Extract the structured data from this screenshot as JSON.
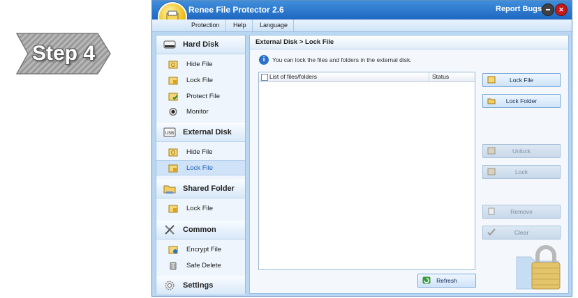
{
  "step": {
    "label": "Step 4"
  },
  "app": {
    "title": "Renee File Protector 2.6",
    "report_bugs": "Report Bugs",
    "menu": [
      "Protection",
      "Help",
      "Language"
    ]
  },
  "sidebar": {
    "categories": [
      {
        "label": "Hard Disk",
        "items": [
          "Hide File",
          "Lock File",
          "Protect File",
          "Monitor"
        ]
      },
      {
        "label": "External Disk",
        "items": [
          "Hide File",
          "Lock File"
        ],
        "active_item": "Lock File"
      },
      {
        "label": "Shared Folder",
        "items": [
          "Lock File"
        ]
      },
      {
        "label": "Common",
        "items": [
          "Encrypt File",
          "Safe Delete"
        ]
      },
      {
        "label": "Settings",
        "items": []
      }
    ]
  },
  "main": {
    "breadcrumb": "External Disk > Lock File",
    "info": "You can lock the files and folders in the external disk.",
    "list_columns": [
      "List of files/folders",
      "Status"
    ],
    "buttons": {
      "lock_file": "Lock File",
      "lock_folder": "Lock Folder",
      "unlock": "Unlock",
      "lock": "Lock",
      "remove": "Remove",
      "clear": "Clear",
      "refresh": "Refresh"
    }
  },
  "colors": {
    "titlebar": "#1f67c1",
    "window_bg": "#b9d7f2",
    "panel_bg": "#f4f8fc"
  }
}
